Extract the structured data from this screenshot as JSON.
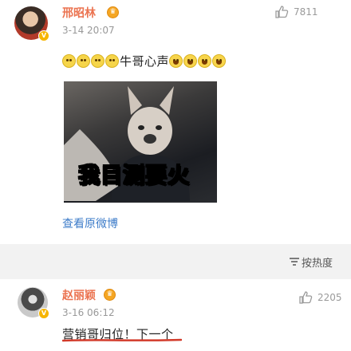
{
  "comments": [
    {
      "user": "邢昭林",
      "time": "3-14 20:07",
      "likes": "7811",
      "vip_label": "",
      "text_prefix_emoji_count": 4,
      "text": "牛哥心声",
      "text_suffix_emoji_count": 4,
      "image": {
        "caption": "我目测要火"
      },
      "link": "查看原微博"
    },
    {
      "user": "赵丽颖",
      "time": "3-16 06:12",
      "likes": "2205",
      "text": "营销哥归位！下一个"
    }
  ],
  "sort_label": "按热度",
  "icons": {
    "like": "thumbs-up-icon",
    "sort": "sort-icon",
    "vip": "vip-badge-icon",
    "verified": "verified-badge-icon",
    "emoji_dog": "doge-emoji-icon",
    "emoji_laugh": "laugh-emoji-icon"
  },
  "colors": {
    "username": "#eb7350",
    "link": "#3d7cc9",
    "underline": "#d23a2a",
    "divider_bg": "#f2f2f2"
  }
}
